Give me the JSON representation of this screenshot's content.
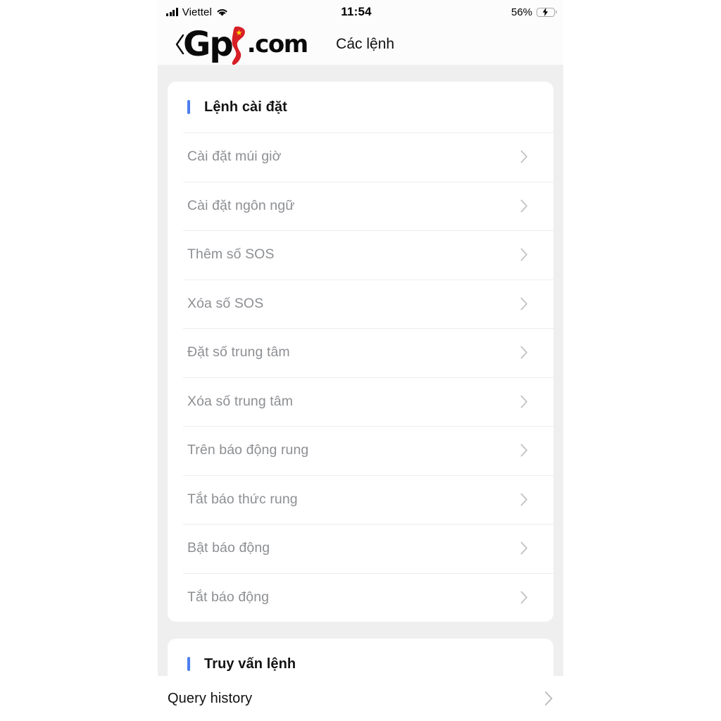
{
  "status_bar": {
    "carrier": "Viettel",
    "time": "11:54",
    "battery_percent": "56%",
    "battery_level": 56,
    "charging": true,
    "signal_icon": "cellular-signal-icon",
    "wifi_icon": "wifi-icon",
    "battery_icon": "battery-charging-icon"
  },
  "nav_bar": {
    "back_icon": "back-chevron-icon",
    "title": "Các lệnh",
    "logo": {
      "text_before": "Gp",
      "text_after": ".com",
      "map_icon": "vietnam-map-icon",
      "map_color": "#d81f26",
      "star_color": "#ffd400"
    }
  },
  "colors": {
    "accent": "#4d7ef0",
    "page_background": "#efeff0",
    "card_background": "#ffffff",
    "row_text": "#8d8f93",
    "heading_text": "#141414",
    "chevron": "#c4c4c6"
  },
  "sections": [
    {
      "title": "Lệnh cài đặt",
      "rows": [
        {
          "label": "Cài đặt múi giờ"
        },
        {
          "label": "Cài đặt ngôn ngữ"
        },
        {
          "label": "Thêm số SOS"
        },
        {
          "label": "Xóa số SOS"
        },
        {
          "label": "Đặt số trung tâm"
        },
        {
          "label": "Xóa số trung tâm"
        },
        {
          "label": "Trên báo động rung"
        },
        {
          "label": "Tắt báo thức rung"
        },
        {
          "label": "Bật báo động"
        },
        {
          "label": "Tắt báo động"
        }
      ]
    },
    {
      "title": "Truy vấn lệnh",
      "rows": []
    }
  ],
  "bottom_bar": {
    "label": "Query history",
    "chevron_icon": "chevron-right-icon"
  }
}
